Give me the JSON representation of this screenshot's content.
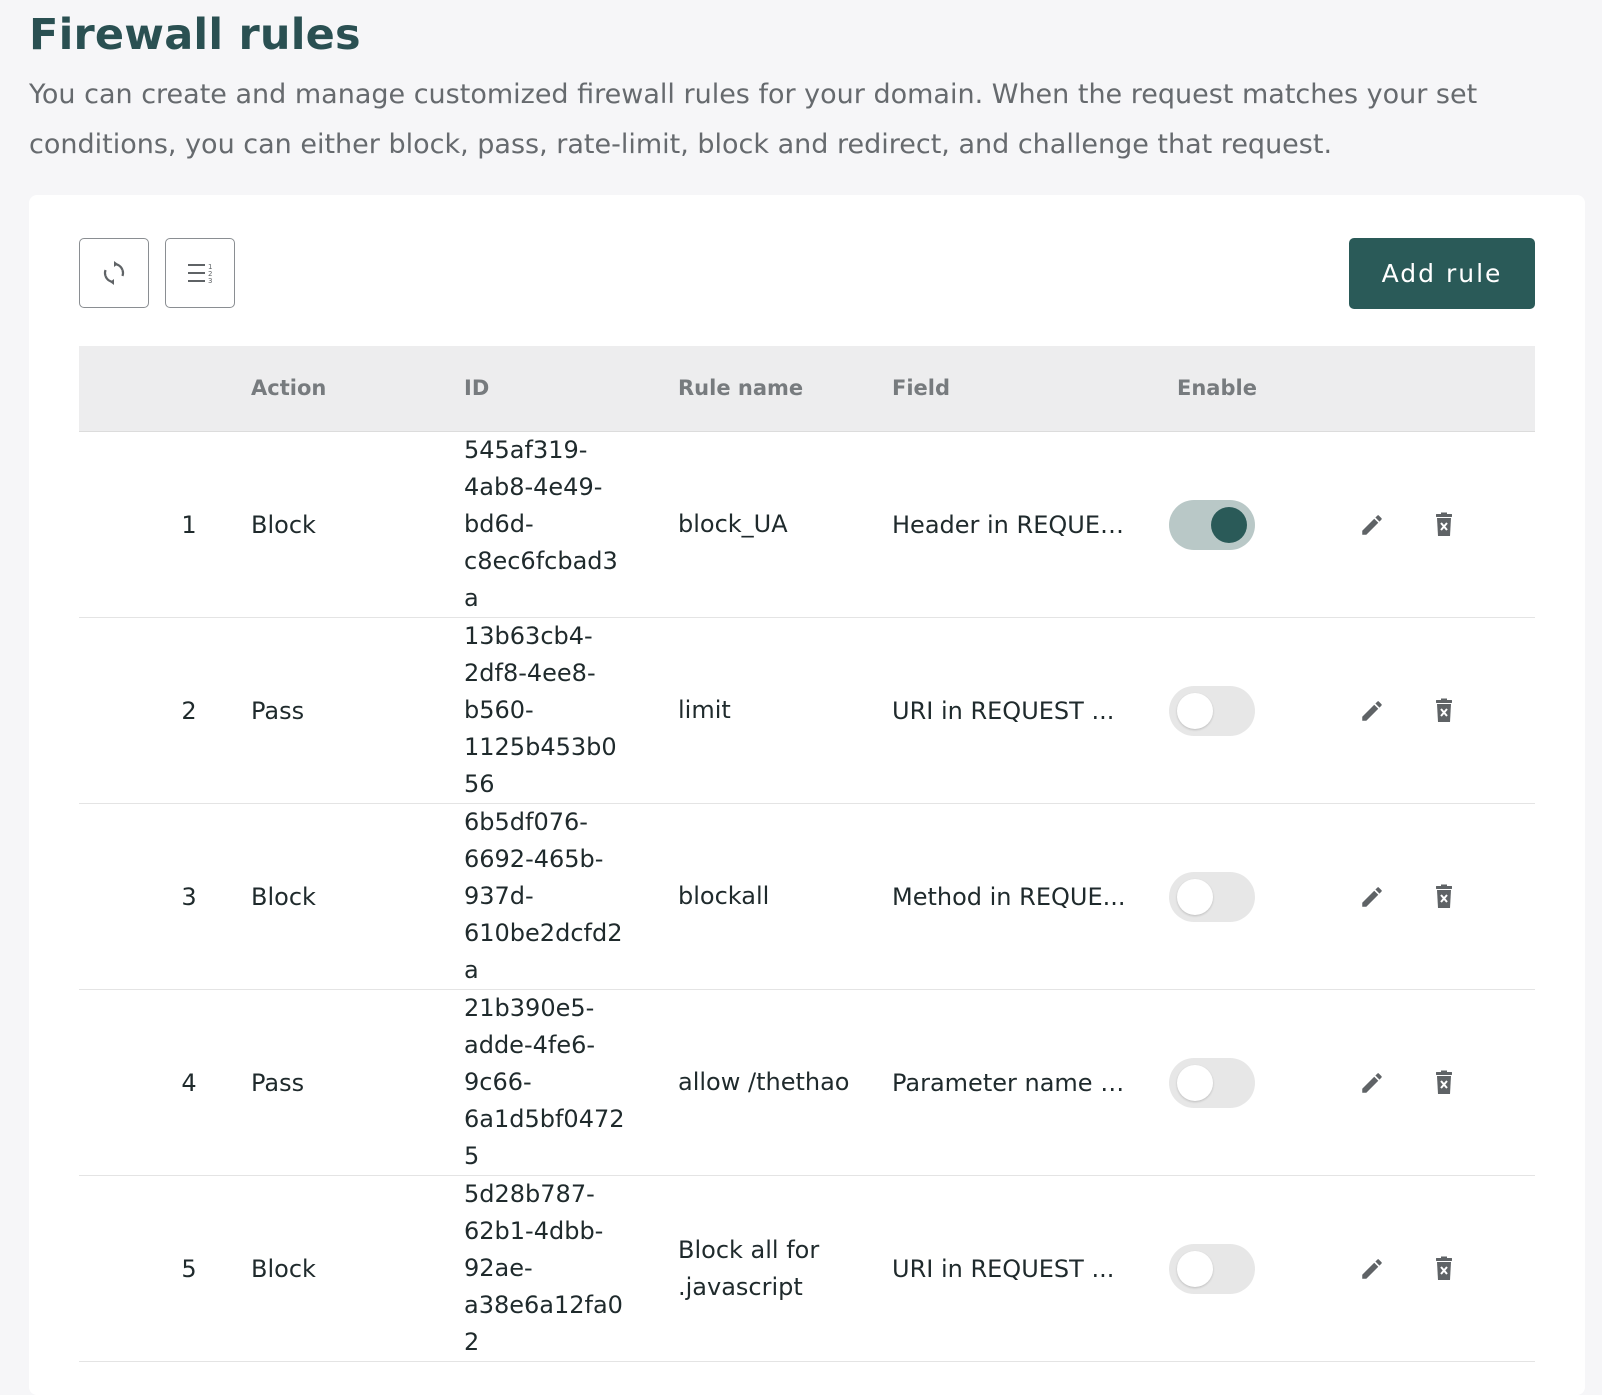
{
  "header": {
    "title": "Firewall rules",
    "description": "You can create and manage customized firewall rules for your domain. When the request matches your set conditions, you can either block, pass, rate-limit, block and redirect, and challenge that request."
  },
  "toolbar": {
    "refresh_icon": "refresh-icon",
    "columns_icon": "column-settings-icon",
    "add_label": "Add rule"
  },
  "colors": {
    "accent": "#2a5a58",
    "title": "#2a5052",
    "toggle_on_track": "#b9c8c7",
    "toggle_off_track": "#e7e7e7"
  },
  "table": {
    "columns": [
      "",
      "Action",
      "ID",
      "Rule name",
      "Field",
      "Enable"
    ],
    "rows": [
      {
        "num": "1",
        "action": "Block",
        "id_lines": [
          "545af319-",
          "4ab8-4e49-",
          "bd6d-",
          "c8ec6fcbad3",
          "a"
        ],
        "name": "block_UA",
        "field": "Header in REQUEST",
        "enabled": true
      },
      {
        "num": "2",
        "action": "Pass",
        "id_lines": [
          "13b63cb4-",
          "2df8-4ee8-",
          "b560-",
          "1125b453b0",
          "56"
        ],
        "name": "limit",
        "field": "URI in REQUEST ...",
        "enabled": false
      },
      {
        "num": "3",
        "action": "Block",
        "id_lines": [
          "6b5df076-",
          "6692-465b-",
          "937d-",
          "610be2dcfd2",
          "a"
        ],
        "name": "blockall",
        "field": "Method in REQUE...",
        "enabled": false
      },
      {
        "num": "4",
        "action": "Pass",
        "id_lines": [
          "21b390e5-",
          "adde-4fe6-",
          "9c66-",
          "6a1d5bf0472",
          "5"
        ],
        "name": "allow /thethao",
        "field": "Parameter name i...",
        "enabled": false
      },
      {
        "num": "5",
        "action": "Block",
        "id_lines": [
          "5d28b787-",
          "62b1-4dbb-",
          "92ae-",
          "a38e6a12fa0",
          "2"
        ],
        "name": "Block all for .javascript",
        "field": "URI in REQUEST ...",
        "enabled": false
      }
    ],
    "row_icons": {
      "edit": "pencil-icon",
      "delete": "trash-icon"
    }
  }
}
